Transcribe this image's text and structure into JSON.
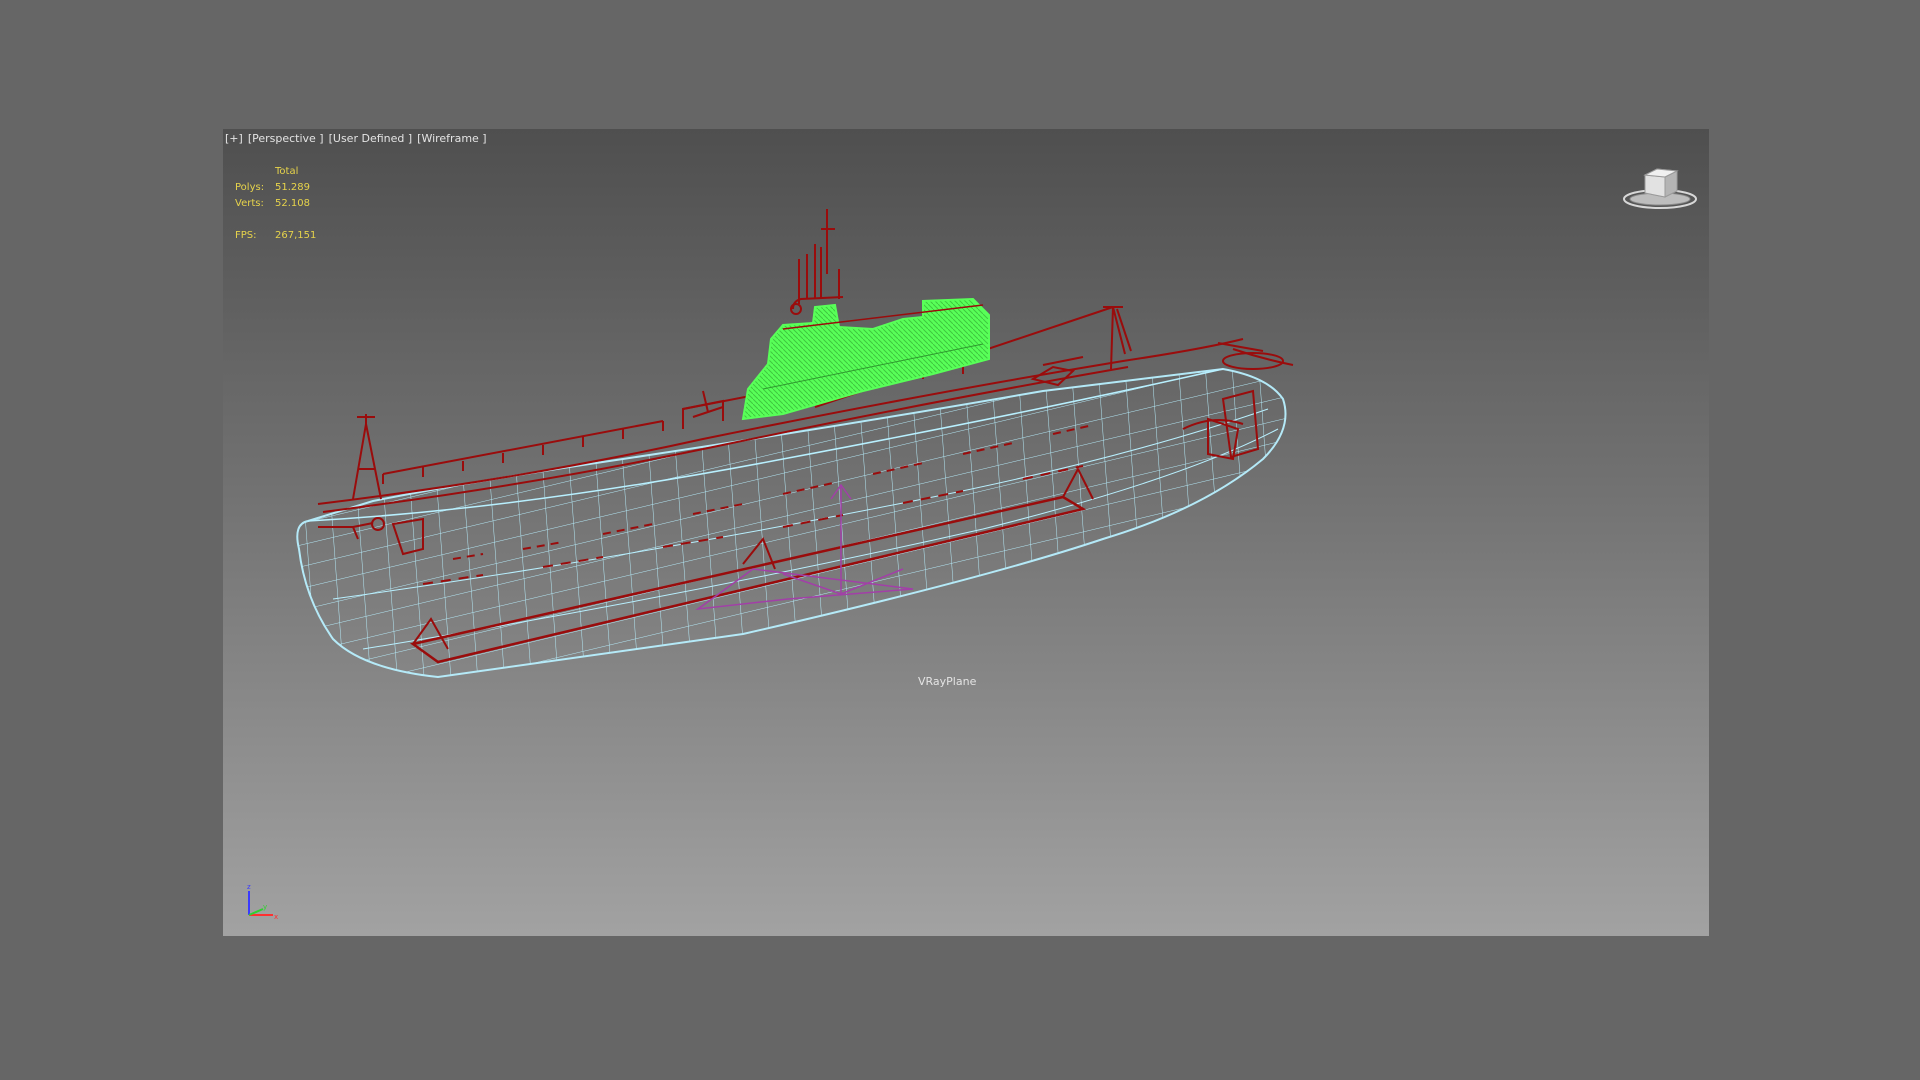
{
  "viewport": {
    "label_parts": [
      "[+]",
      "[Perspective ]",
      "[User Defined ]",
      "[Wireframe ]"
    ]
  },
  "stats": {
    "header": "Total",
    "polys_label": "Polys:",
    "polys_value": "51.289",
    "verts_label": "Verts:",
    "verts_value": "52.108",
    "fps_label": "FPS:",
    "fps_value": "267,151"
  },
  "scene": {
    "object_label": "VRayPlane",
    "colors": {
      "hull_wire": "#b8f0ff",
      "detail_wire": "#9a0c0c",
      "selected": "#58ff58",
      "vray_plane": "#a23fa8",
      "stats_text": "#e6d34b"
    }
  },
  "viewcube": {
    "icon": "viewcube-icon"
  },
  "axis_gizmo": {
    "z": "z",
    "y": "y",
    "x": "x"
  }
}
